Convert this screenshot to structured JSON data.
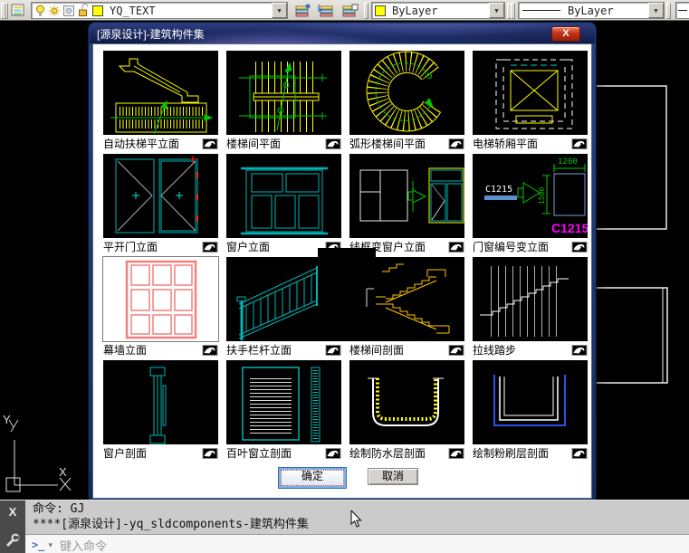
{
  "toolbar": {
    "layer_value": "YQ_TEXT",
    "color_value": "ByLayer",
    "linetype_value": "ByLayer"
  },
  "icons": {
    "dropdown": "▼",
    "close": "X",
    "cmd_close": "X",
    "input_caret": "▾",
    "prompt": ">_"
  },
  "dialog": {
    "title": "[源泉设计]-建筑构件集",
    "ok_label": "确定",
    "cancel_label": "取消",
    "tiles": [
      {
        "label": "自动扶梯平立面"
      },
      {
        "label": "楼梯间平面"
      },
      {
        "label": "弧形楼梯间平面"
      },
      {
        "label": "电梯轿厢平面"
      },
      {
        "label": "平开门立面"
      },
      {
        "label": "窗户立面"
      },
      {
        "label": "线框变窗户立面"
      },
      {
        "label": "门窗编号变立面",
        "annotations": {
          "dim_top": "1200",
          "dim_side": "1500",
          "code": "C1215",
          "badge": "C1215"
        }
      },
      {
        "label": "幕墙立面"
      },
      {
        "label": "扶手栏杆立面"
      },
      {
        "label": "楼梯间剖面"
      },
      {
        "label": "拉线踏步"
      },
      {
        "label": "窗户剖面"
      },
      {
        "label": "百叶窗立剖面"
      },
      {
        "label": "绘制防水层剖面"
      },
      {
        "label": "绘制粉刷层剖面"
      }
    ]
  },
  "command": {
    "line1": "命令: GJ",
    "line2": "****[源泉设计]-yq_sldcomponents-建筑构件集",
    "input_placeholder": "键入命令"
  },
  "ucs": {
    "x": "X",
    "y": "Y"
  },
  "colors": {
    "cad_yellow": "#ffff00",
    "cad_gold": "#ffc800",
    "cad_teal": "#00b3b3",
    "cad_green": "#00c800",
    "magenta": "#ff00ff",
    "salmon": "#f28080",
    "steel_blue": "#7b9cd6",
    "dialog_navy": "#1d4277"
  }
}
